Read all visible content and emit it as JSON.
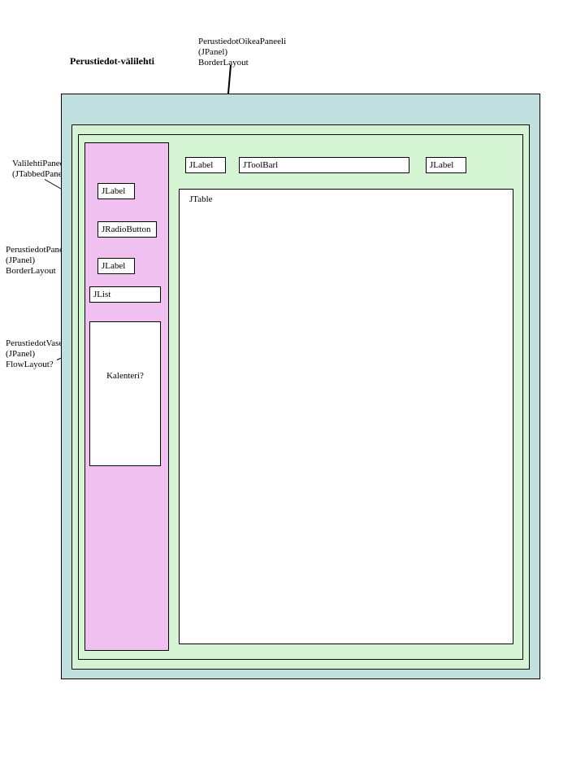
{
  "title": "Perustiedot-välilehti",
  "annotations": {
    "top": "PerustiedotOikeaPaneeli\n(JPanel)\nBorderLayout",
    "left1": "ValilehtiPaneeli\n(JTabbedPane)",
    "left2": "PerustiedotPaneeli\n(JPanel)\nBorderLayout",
    "left3": "PerustiedotVasenPaneeli\n(JPanel)\nFlowLayout?"
  },
  "leftPanel": {
    "jlabel1": "JLabel",
    "radio": "JRadioButton",
    "jlabel2": "JLabel",
    "jlist": "JList",
    "calendar": "Kalenteri?"
  },
  "rightPanel": {
    "label1": "JLabel",
    "toolbar": "JToolBarl",
    "label2": "JLabel",
    "table": "JTable"
  }
}
